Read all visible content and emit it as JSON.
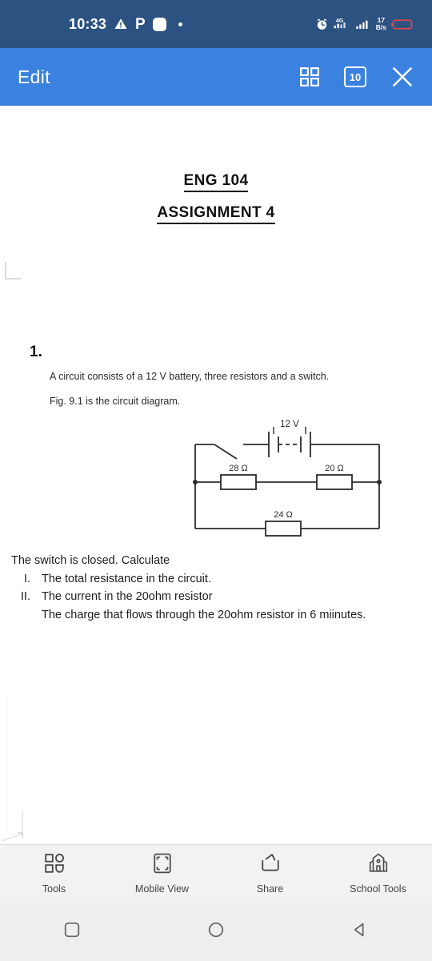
{
  "status_bar": {
    "time": "10:33",
    "left_icons": [
      "warning-triangle-icon",
      "parking-p-icon",
      "rounded-square-icon",
      "dot-icon"
    ],
    "network_type": "4G",
    "data_rate_value": "17",
    "data_rate_unit": "B/s",
    "right_icons": [
      "alarm-clock-icon",
      "signal-4g-icon",
      "signal-bars-icon",
      "battery-low-icon"
    ],
    "background_color": "#2c5282"
  },
  "app_bar": {
    "title": "Edit",
    "grid_icon": "grid-view-icon",
    "tab_count": "10",
    "close_icon": "close-icon",
    "background_color": "#3b82e0"
  },
  "document": {
    "title": "ENG 104",
    "subtitle": "ASSIGNMENT 4",
    "question_number": "1.",
    "intro_lines": [
      "A circuit consists of a 12 V battery, three resistors and a switch.",
      "Fig. 9.1 is the circuit diagram."
    ],
    "prompt": "The switch is closed. Calculate",
    "items": [
      {
        "numeral": "I.",
        "text": "The total resistance in the circuit."
      },
      {
        "numeral": "II.",
        "text": "The current in the 20ohm resistor"
      },
      {
        "numeral": "",
        "text": "The charge that flows through the 20ohm resistor in 6 miinutes."
      }
    ]
  },
  "circuit": {
    "battery_label": "12 V",
    "resistor_top_left": "28 Ω",
    "resistor_top_right": "20 Ω",
    "resistor_bottom": "24 Ω",
    "switch_state": "open",
    "line_color": "#2b2b2b"
  },
  "chart_data": {
    "type": "diagram",
    "title": "Fig. 9.1 circuit diagram",
    "elements": [
      {
        "kind": "battery",
        "label": "12 V",
        "position": "top-branch",
        "cells": 2
      },
      {
        "kind": "switch",
        "label": "",
        "position": "top-branch-left",
        "state": "open"
      },
      {
        "kind": "resistor",
        "label": "28 Ω",
        "value": 28,
        "unit": "ohm",
        "position": "middle-branch-left"
      },
      {
        "kind": "resistor",
        "label": "20 Ω",
        "value": 20,
        "unit": "ohm",
        "position": "middle-branch-right"
      },
      {
        "kind": "resistor",
        "label": "24 Ω",
        "value": 24,
        "unit": "ohm",
        "position": "bottom-branch"
      }
    ],
    "source_voltage": 12,
    "source_unit": "V"
  },
  "bottom_toolbar": {
    "items": [
      {
        "label": "Tools",
        "icon": "tools-grid-icon"
      },
      {
        "label": "Mobile View",
        "icon": "mobile-view-frame-icon"
      },
      {
        "label": "Share",
        "icon": "share-arrow-icon"
      },
      {
        "label": "School Tools",
        "icon": "school-building-icon"
      }
    ]
  },
  "nav_bar": {
    "buttons": [
      {
        "icon": "recents-square-icon"
      },
      {
        "icon": "home-circle-icon"
      },
      {
        "icon": "back-triangle-icon"
      }
    ]
  }
}
